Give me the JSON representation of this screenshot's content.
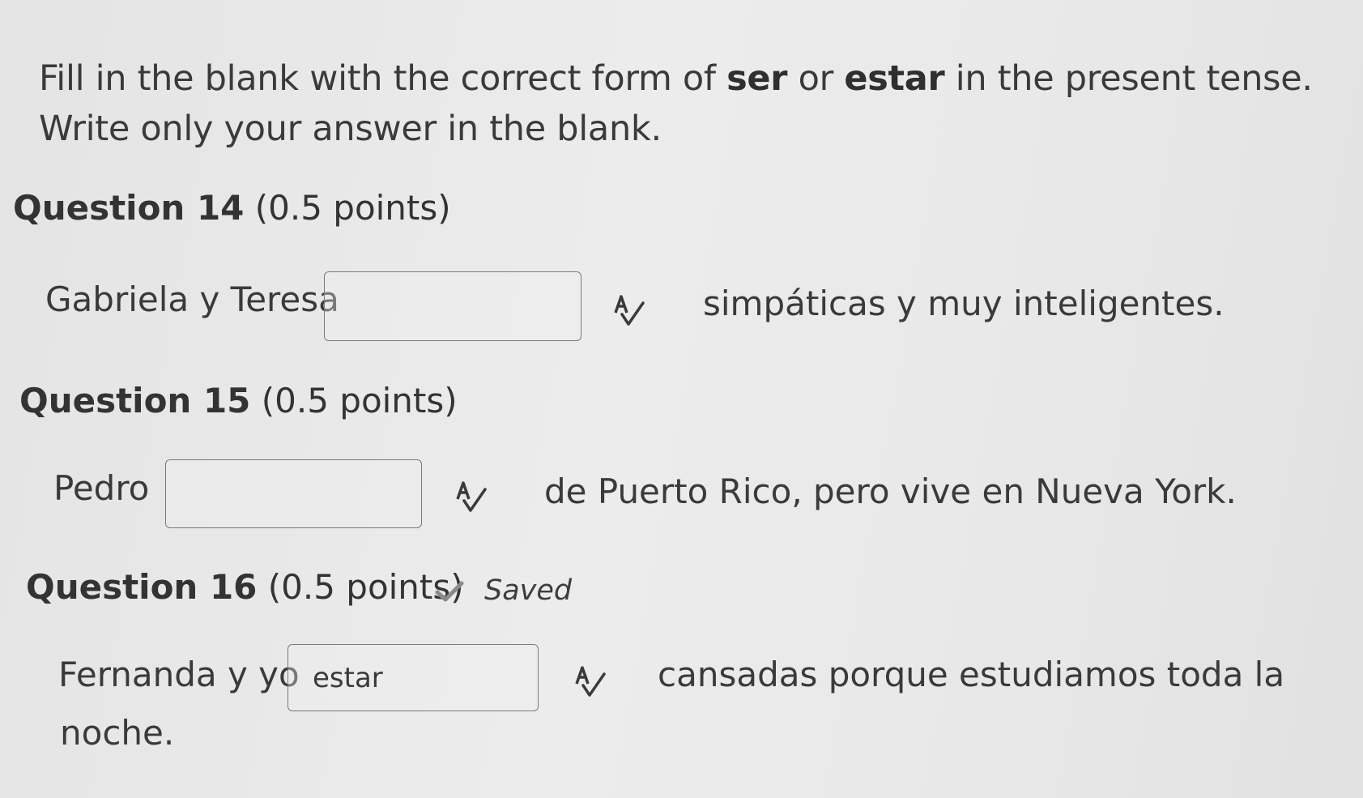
{
  "instructions": {
    "part1": "Fill in the blank with the correct form of ",
    "bold1": "ser",
    "part2": " or ",
    "bold2": "estar",
    "part3": " in the present tense. Write only your answer in the blank."
  },
  "questions": [
    {
      "number": "Question 14",
      "points": "(0.5 points)",
      "before": "Gabriela y Teresa",
      "answer": "",
      "after": "simpáticas y muy inteligentes."
    },
    {
      "number": "Question 15",
      "points": "(0.5 points)",
      "before": "Pedro",
      "answer": "",
      "after": "de Puerto Rico, pero vive en Nueva York."
    },
    {
      "number": "Question 16",
      "points": "(0.5 points)",
      "status": "Saved",
      "before": "Fernanda y yo",
      "answer": "estar",
      "after": "cansadas porque estudiamos toda la",
      "after_line2": "noche."
    }
  ],
  "icons": {
    "spellcheck": "spellcheck-icon",
    "saved": "checkmark-icon"
  }
}
